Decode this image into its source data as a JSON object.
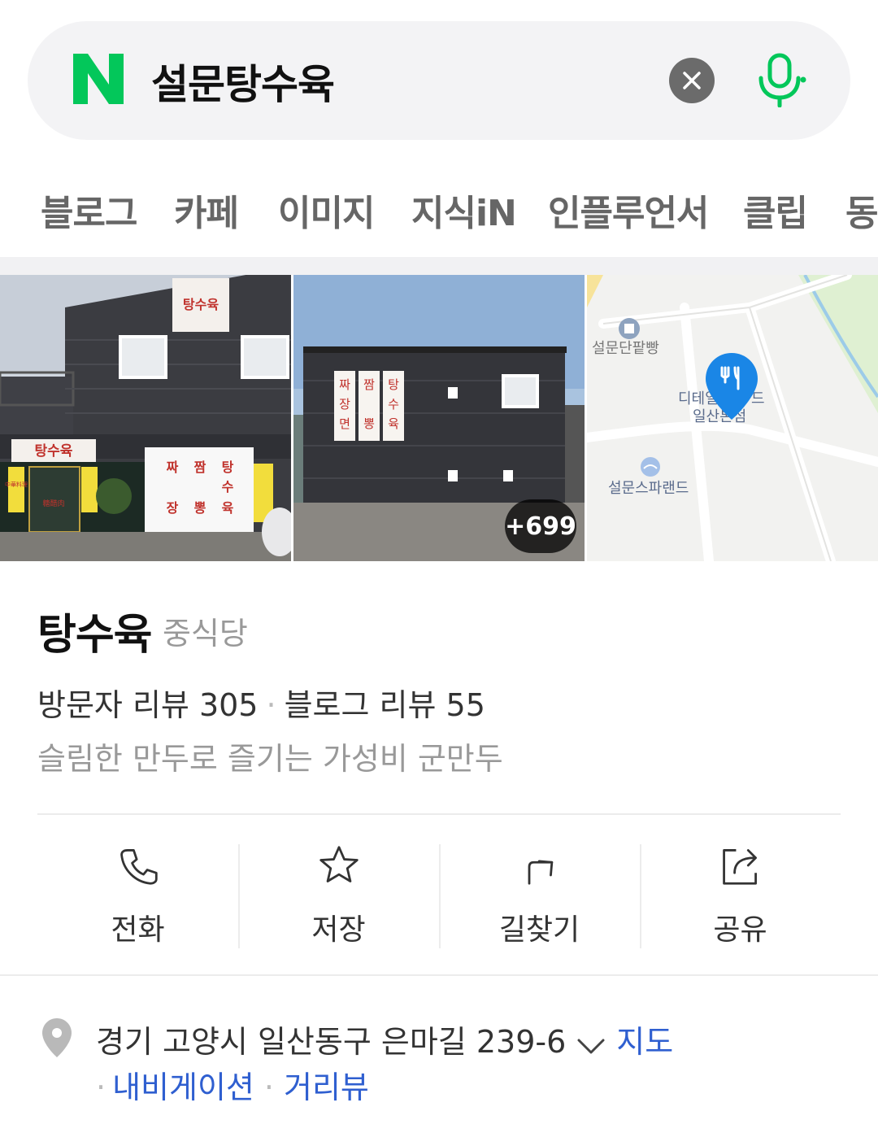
{
  "search": {
    "logo_letter": "N",
    "query": "설문탕수육"
  },
  "tabs": [
    "블로그",
    "카페",
    "이미지",
    "지식iN",
    "인플루언서",
    "클립",
    "동"
  ],
  "photos": {
    "photo1_signs": [
      "탕수육",
      "탕수육",
      "짜",
      "짬",
      "탕",
      "장",
      "뽕",
      "수",
      "육",
      "糖醋肉",
      "中華料理"
    ],
    "photo2_signs": [
      "짜",
      "장",
      "면",
      "짬",
      "뽕",
      "탕",
      "수",
      "육"
    ],
    "more_count": "+699",
    "map_labels": {
      "poi1": "설문단팥빵",
      "poi2_line1": "디테일",
      "poi2_line1_b": "드",
      "poi2_line2": "일산본점",
      "poi3": "설문스파랜드"
    }
  },
  "place": {
    "name": "탕수육",
    "category": "중식당",
    "visitor_reviews": "방문자 리뷰 305",
    "blog_reviews": "블로그 리뷰 55",
    "dot": "·",
    "tagline": "슬림한 만두로 즐기는 가성비 군만두"
  },
  "actions": [
    {
      "label": "전화",
      "icon": "phone-icon"
    },
    {
      "label": "저장",
      "icon": "star-icon"
    },
    {
      "label": "길찾기",
      "icon": "directions-icon"
    },
    {
      "label": "공유",
      "icon": "share-icon"
    }
  ],
  "address": {
    "text": "경기 고양시 일산동구 은마길 239-6",
    "map_link": "지도",
    "navigation_link": "내비게이션",
    "street_view_link": "거리뷰",
    "dot": "·"
  },
  "colors": {
    "naver_green": "#03C75A",
    "link_blue": "#2F5FD0",
    "map_pin_blue": "#1A86E6"
  }
}
